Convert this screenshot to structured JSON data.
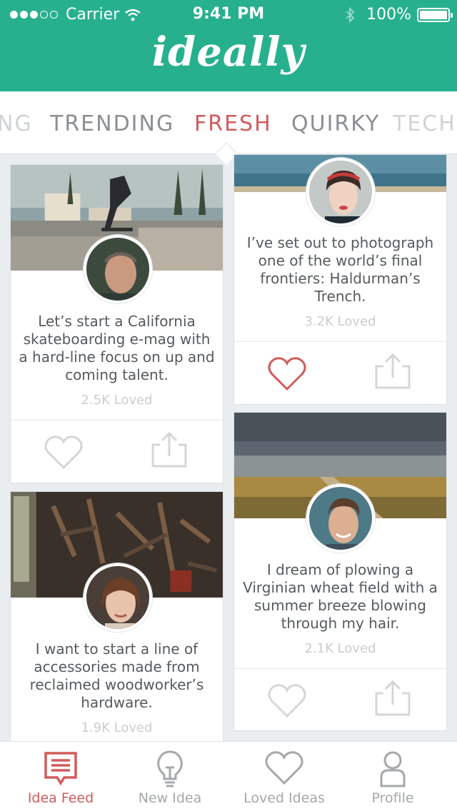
{
  "status_bar": {
    "carrier": "Carrier",
    "time": "9:41 PM",
    "battery": "100%"
  },
  "header": {
    "logo": "ideally"
  },
  "categories": {
    "items": [
      "NG",
      "TRENDING",
      "FRESH",
      "QUIRKY",
      "TECH"
    ],
    "active": "FRESH"
  },
  "feed": {
    "cards": [
      {
        "text": "Let’s start a California skateboarding e-mag with a hard-line focus on up and coming talent.",
        "loved": "2.5K Loved",
        "liked": false
      },
      {
        "text": "I’ve set out to photograph one of the world’s final frontiers: Haldurman’s Trench.",
        "loved": "3.2K Loved",
        "liked": true
      },
      {
        "text": "I want to start a line of accessories made from reclaimed woodworker’s hardware.",
        "loved": "1.9K Loved",
        "liked": false
      },
      {
        "text": "I dream of plowing a Virginian wheat field with a summer breeze blowing through my hair.",
        "loved": "2.1K Loved",
        "liked": false
      }
    ]
  },
  "tabbar": {
    "items": [
      {
        "label": "Idea Feed",
        "icon": "feed-icon",
        "active": true
      },
      {
        "label": "New Idea",
        "icon": "lightbulb-icon",
        "active": false
      },
      {
        "label": "Loved Ideas",
        "icon": "heart-icon",
        "active": false
      },
      {
        "label": "Profile",
        "icon": "person-icon",
        "active": false
      }
    ]
  },
  "colors": {
    "brand": "#27b08e",
    "accent": "#d25b5b",
    "muted": "#c9cdd0"
  }
}
